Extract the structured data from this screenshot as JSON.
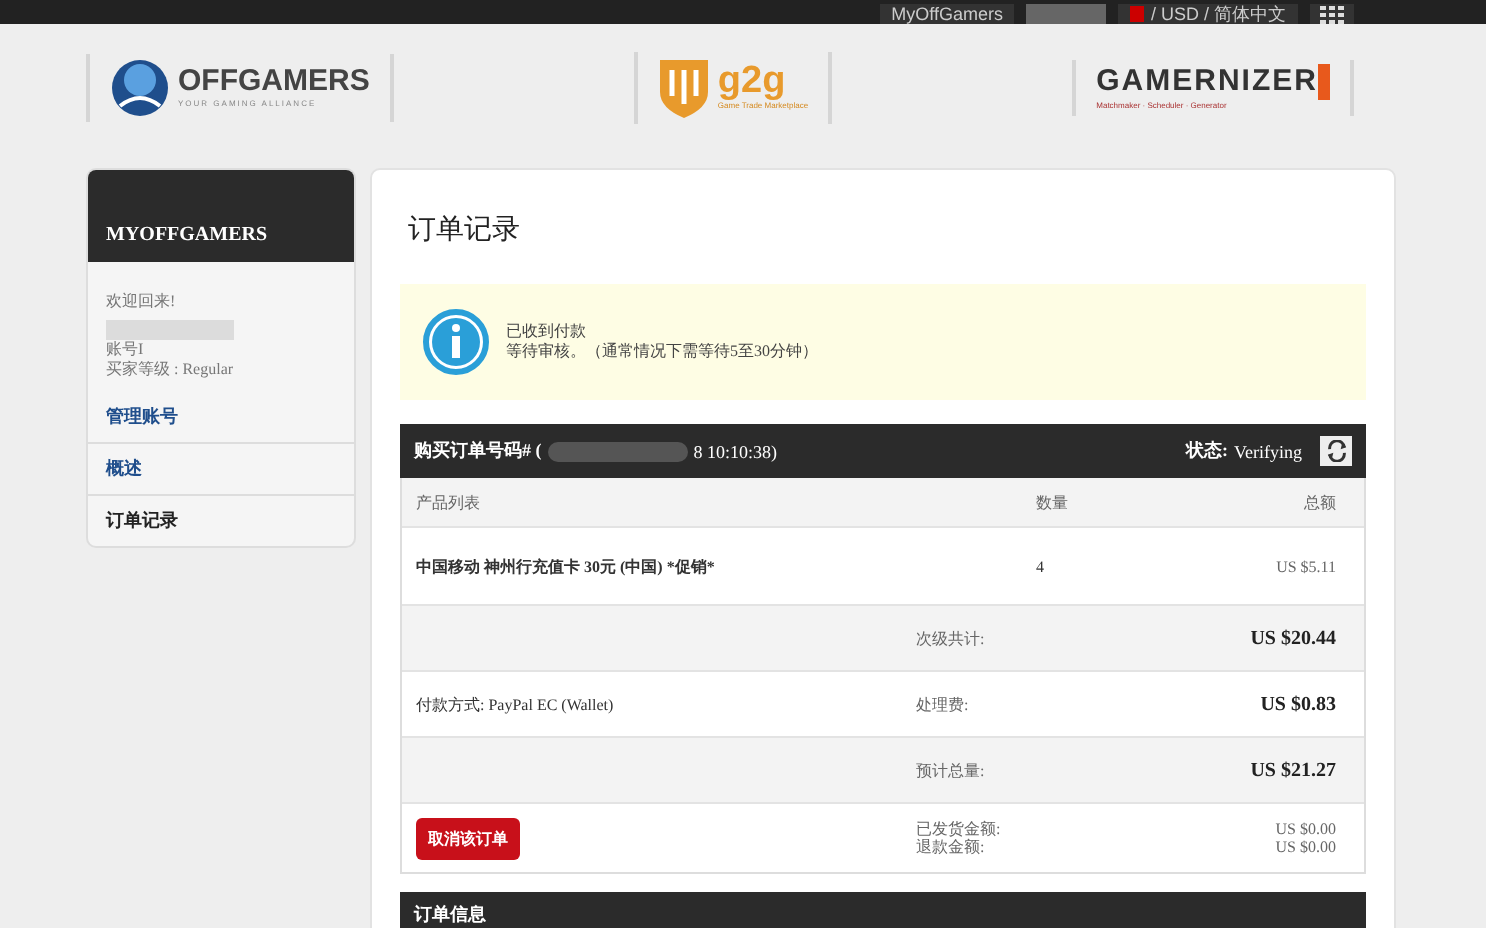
{
  "top_bar": {
    "account_link": "MyOffGamers",
    "locale": "/ USD / 简体中文"
  },
  "logos": [
    {
      "kind": "offgamers",
      "name": "OFFGAMERS",
      "tagline": "YOUR GAMING ALLIANCE"
    },
    {
      "kind": "g2g",
      "name": "g2g",
      "tagline": "Game Trade Marketplace"
    },
    {
      "kind": "gamernizer",
      "name": "GAMERNIZER",
      "tagline": "Matchmaker · Scheduler · Generator"
    }
  ],
  "sidebar": {
    "title": "MYOFFGAMERS",
    "welcome": "欢迎回来!",
    "account_label": "账号I",
    "level": "买家等级 : Regular",
    "items": [
      {
        "label": "管理账号",
        "selected": false
      },
      {
        "label": "概述",
        "selected": false
      },
      {
        "label": "订单记录",
        "selected": true
      }
    ]
  },
  "page_title": "订单记录",
  "notice": {
    "title": "已收到付款",
    "message": "等待审核。（通常情况下需等待5至30分钟）"
  },
  "order": {
    "number_label": "购买订单号码# (",
    "date_tail": "8 10:10:38)",
    "status_label": "状态:",
    "status": "Verifying",
    "columns": [
      "产品列表",
      "数量",
      "总额"
    ],
    "items": [
      {
        "product": "中国移动 神州行充值卡 30元 (中国) *促销*",
        "quantity": "4",
        "total": "US $5.11"
      }
    ],
    "subtotal": {
      "label": "次级共计:",
      "value": "US $20.44"
    },
    "payment_method": "付款方式: PayPal EC (Wallet)",
    "fee": {
      "label": "处理费:",
      "value": "US $0.83"
    },
    "grand_total": {
      "label": "预计总量:",
      "value": "US $21.27"
    },
    "cancel_button": "取消该订单",
    "delivered": {
      "label": "已发货金额:",
      "value": "US $0.00"
    },
    "refunded": {
      "label": "退款金额:",
      "value": "US $0.00"
    }
  },
  "next_section": {
    "title": "订单信息"
  }
}
